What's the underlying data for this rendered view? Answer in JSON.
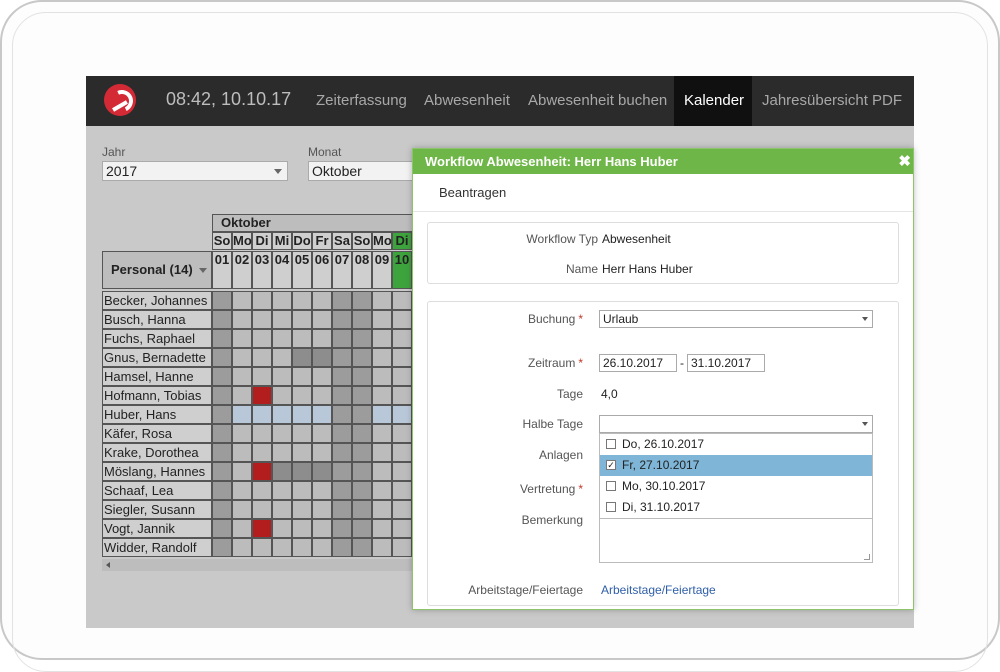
{
  "nav": {
    "clock": "08:42, 10.10.17",
    "items": [
      "Zeiterfassung",
      "Abwesenheit",
      "Abwesenheit buchen",
      "Kalender",
      "Jahresübersicht PDF"
    ],
    "active": "Kalender"
  },
  "filters": {
    "year_label": "Jahr",
    "year_value": "2017",
    "month_label": "Monat",
    "month_value": "Oktober"
  },
  "calendar": {
    "month": "Oktober",
    "personal_header": "Personal (14)",
    "weekdays": [
      "So",
      "Mo",
      "Di",
      "Mi",
      "Do",
      "Fr",
      "Sa",
      "So",
      "Mo",
      "Di"
    ],
    "days": [
      "01",
      "02",
      "03",
      "04",
      "05",
      "06",
      "07",
      "08",
      "09",
      "10"
    ],
    "employees": [
      "Becker, Johannes",
      "Busch, Hanna",
      "Fuchs, Raphael",
      "Gnus, Bernadette",
      "Hamsel, Hanne",
      "Hofmann, Tobias",
      "Huber, Hans",
      "Käfer, Rosa",
      "Krake, Dorothea",
      "Möslang, Hannes",
      "Schaaf, Lea",
      "Siegler, Susann",
      "Vogt, Jannik",
      "Widder, Randolf"
    ]
  },
  "modal": {
    "title": "Workflow Abwesenheit: Herr Hans Huber",
    "close": "✖",
    "tab": "Beantragen",
    "workflow_typ_label": "Workflow Typ",
    "workflow_typ_value": "Abwesenheit",
    "name_label": "Name",
    "name_value": "Herr Hans Huber",
    "buchung_label": "Buchung",
    "buchung_value": "Urlaub",
    "zeitraum_label": "Zeitraum",
    "zeitraum_from": "26.10.2017",
    "zeitraum_sep": "-",
    "zeitraum_to": "31.10.2017",
    "tage_label": "Tage",
    "tage_value": "4,0",
    "halbe_tage_label": "Halbe Tage",
    "anlagen_label": "Anlagen",
    "vertretung_label": "Vertretung",
    "bemerkung_label": "Bemerkung",
    "required_mark": "*",
    "options": [
      {
        "label": "Do, 26.10.2017",
        "checked": false
      },
      {
        "label": "Fr, 27.10.2017",
        "checked": true
      },
      {
        "label": "Mo, 30.10.2017",
        "checked": false
      },
      {
        "label": "Di, 31.10.2017",
        "checked": false
      }
    ],
    "check_mark": "✓",
    "arbeitstage_label": "Arbeitstage/Feiertage",
    "arbeitstage_link": "Arbeitstage/Feiertage"
  }
}
